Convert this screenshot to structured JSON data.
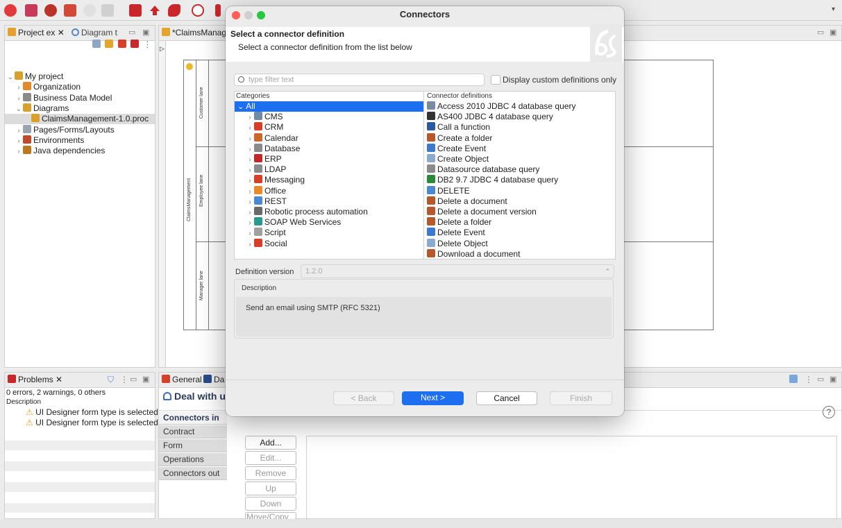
{
  "toolbar": {
    "overflow": "▾"
  },
  "project": {
    "tabs": [
      "Project ex ✕",
      "Diagram t"
    ],
    "tree": [
      {
        "label": "My project",
        "indent": 0,
        "twisty": "⌄",
        "icon": "project-icon",
        "color": "#d9a12c"
      },
      {
        "label": "Organization",
        "indent": 1,
        "twisty": "›",
        "icon": "organization-icon",
        "color": "#e28a2a"
      },
      {
        "label": "Business Data Model",
        "indent": 1,
        "twisty": "›",
        "icon": "database-icon",
        "color": "#8a8a8a"
      },
      {
        "label": "Diagrams",
        "indent": 1,
        "twisty": "⌄",
        "icon": "diagram-icon",
        "color": "#d9a12c"
      },
      {
        "label": "ClaimsManagement-1.0.proc",
        "indent": 2,
        "twisty": "",
        "icon": "process-icon",
        "color": "#d9a12c",
        "selected": true
      },
      {
        "label": "Pages/Forms/Layouts",
        "indent": 1,
        "twisty": "›",
        "icon": "page-icon",
        "color": "#9aa3b0"
      },
      {
        "label": "Environments",
        "indent": 1,
        "twisty": "›",
        "icon": "environment-icon",
        "color": "#c24a2a"
      },
      {
        "label": "Java dependencies",
        "indent": 1,
        "twisty": "›",
        "icon": "java-icon",
        "color": "#b87a1c"
      }
    ]
  },
  "editor": {
    "tab": "*ClaimsManage",
    "pool": "ClaimsManagement",
    "lanes": [
      "Customer lane",
      "Employee lane",
      "Manager lane"
    ]
  },
  "problems": {
    "tab": "Problems ✕",
    "summary": "0 errors, 2 warnings, 0 others",
    "header": "Description",
    "items": [
      "UI Designer form type is selected a",
      "UI Designer form type is selected a"
    ]
  },
  "properties": {
    "tabs": [
      "General",
      "Da"
    ],
    "title": "Deal with un",
    "section_title": "Connectors in",
    "side_tabs": [
      "Connectors in",
      "Contract",
      "Form",
      "Operations",
      "Connectors out"
    ],
    "buttons": [
      "Add...",
      "Edit...",
      "Remove",
      "Up",
      "Down",
      "Move/Copy..."
    ],
    "help": "?"
  },
  "dialog": {
    "title": "Connectors",
    "heading": "Select a connector definition",
    "subheading": "Select a connector definition from the list below",
    "filter_placeholder": "type filter text",
    "custom_only_label": "Display custom definitions only",
    "categories_header": "Categories",
    "definitions_header": "Connector definitions",
    "categories": [
      {
        "label": "All",
        "selected": true,
        "icon": "",
        "color": ""
      },
      {
        "label": "CMS",
        "icon": "cms-icon",
        "color": "#6f8aa6"
      },
      {
        "label": "CRM",
        "icon": "crm-icon",
        "color": "#d6402a"
      },
      {
        "label": "Calendar",
        "icon": "calendar-icon",
        "color": "#c9692a"
      },
      {
        "label": "Database",
        "icon": "database-icon",
        "color": "#8b8b8b"
      },
      {
        "label": "ERP",
        "icon": "erp-icon",
        "color": "#c0282a"
      },
      {
        "label": "LDAP",
        "icon": "ldap-icon",
        "color": "#8b8b8b"
      },
      {
        "label": "Messaging",
        "icon": "messaging-icon",
        "color": "#d6402a"
      },
      {
        "label": "Office",
        "icon": "office-icon",
        "color": "#e68a2a"
      },
      {
        "label": "REST",
        "icon": "rest-icon",
        "color": "#4a8ad0"
      },
      {
        "label": "Robotic process automation",
        "icon": "robot-icon",
        "color": "#6a6a6a"
      },
      {
        "label": "SOAP Web Services",
        "icon": "soap-icon",
        "color": "#2a9a8a"
      },
      {
        "label": "Script",
        "icon": "script-icon",
        "color": "#a0a0a0"
      },
      {
        "label": "Social",
        "icon": "social-icon",
        "color": "#d6402a"
      }
    ],
    "definitions": [
      {
        "label": "Access 2010 JDBC 4 database query",
        "icon": "jdbc-icon",
        "color": "#7a8aa0"
      },
      {
        "label": "AS400 JDBC 4 database query",
        "icon": "as400-icon",
        "color": "#333333"
      },
      {
        "label": "Call a function",
        "icon": "function-icon",
        "color": "#2a5aa0"
      },
      {
        "label": "Create a folder",
        "icon": "folder-icon",
        "color": "#b8582a"
      },
      {
        "label": "Create Event",
        "icon": "event-icon",
        "color": "#3a7ad0"
      },
      {
        "label": "Create Object",
        "icon": "object-icon",
        "color": "#8aaad0"
      },
      {
        "label": "Datasource database query",
        "icon": "datasource-icon",
        "color": "#8b8b8b"
      },
      {
        "label": "DB2 9.7 JDBC 4 database query",
        "icon": "db2-icon",
        "color": "#2a8a3a"
      },
      {
        "label": "DELETE",
        "icon": "delete-rest-icon",
        "color": "#4a8ad0"
      },
      {
        "label": "Delete a document",
        "icon": "document-icon",
        "color": "#b8582a"
      },
      {
        "label": "Delete a document version",
        "icon": "document-icon",
        "color": "#b8582a"
      },
      {
        "label": "Delete a folder",
        "icon": "folder-icon",
        "color": "#b8582a"
      },
      {
        "label": "Delete Event",
        "icon": "event-icon",
        "color": "#3a7ad0"
      },
      {
        "label": "Delete Object",
        "icon": "object-icon",
        "color": "#8aaad0"
      },
      {
        "label": "Download a document",
        "icon": "document-icon",
        "color": "#b8582a"
      }
    ],
    "version_label": "Definition version",
    "version_value": "1.2.0",
    "description_label": "Description",
    "description_text": "Send an email using SMTP (RFC 5321)",
    "buttons": {
      "back": "< Back",
      "next": "Next >",
      "cancel": "Cancel",
      "finish": "Finish"
    },
    "accent": "#1e6ff0"
  }
}
